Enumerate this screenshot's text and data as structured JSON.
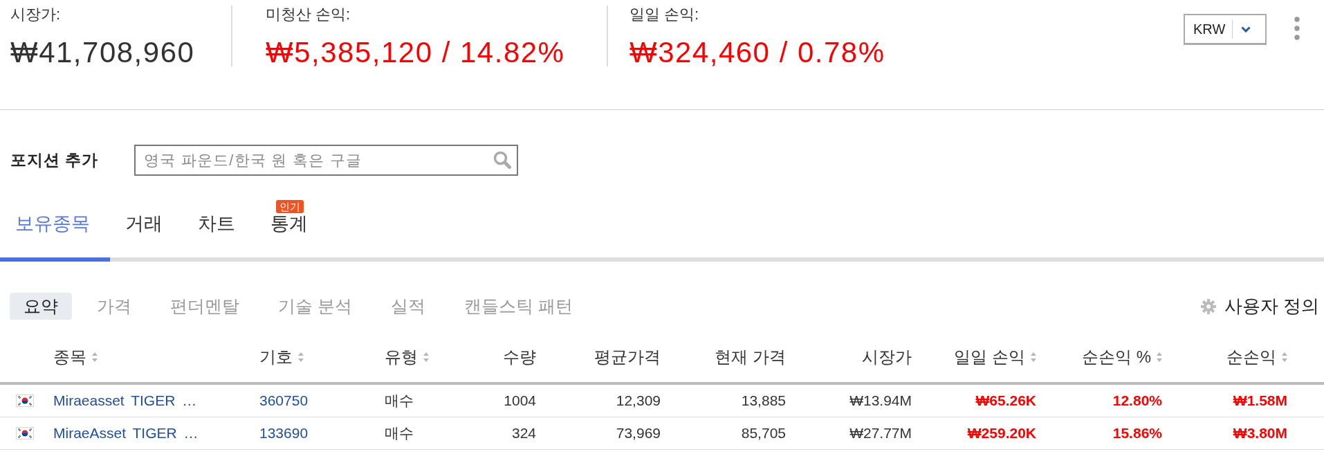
{
  "summary": [
    {
      "label": "시장가:",
      "value": "₩41,708,960",
      "kind": "total"
    },
    {
      "label": "미청산 손익:",
      "value": "₩5,385,120 / 14.82%",
      "kind": "change"
    },
    {
      "label": "일일 손익:",
      "value": "₩324,460 / 0.78%",
      "kind": "change"
    }
  ],
  "currency": {
    "value": "KRW"
  },
  "add_position": {
    "label": "포지션 추가",
    "placeholder": "영국 파운드/한국 원 혹은 구글"
  },
  "tabs": [
    {
      "label": "보유종목",
      "selected": true
    },
    {
      "label": "거래",
      "selected": false
    },
    {
      "label": "차트",
      "selected": false
    },
    {
      "label": "통계",
      "selected": false,
      "badge": "인기"
    }
  ],
  "views": [
    {
      "label": "요약",
      "selected": true
    },
    {
      "label": "가격",
      "selected": false
    },
    {
      "label": "편더멘탈",
      "selected": false
    },
    {
      "label": "기술 분석",
      "selected": false
    },
    {
      "label": "실적",
      "selected": false
    },
    {
      "label": "캔들스틱 패턴",
      "selected": false
    }
  ],
  "customize": {
    "label": "사용자 정의"
  },
  "table": {
    "columns": [
      {
        "label": "종목",
        "kind": "name",
        "sortable": true
      },
      {
        "label": "기호",
        "kind": "symbol",
        "sortable": true
      },
      {
        "label": "유형",
        "kind": "text",
        "sortable": true
      },
      {
        "label": "수량",
        "kind": "number",
        "sortable": false
      },
      {
        "label": "평균가격",
        "kind": "number",
        "sortable": false
      },
      {
        "label": "현재 가격",
        "kind": "number",
        "sortable": false
      },
      {
        "label": "시장가",
        "kind": "number",
        "sortable": false
      },
      {
        "label": "일일 손익",
        "kind": "change",
        "sortable": true
      },
      {
        "label": "순손익 %",
        "kind": "change",
        "sortable": true
      },
      {
        "label": "순손익",
        "kind": "change",
        "sortable": true
      }
    ],
    "rows": [
      {
        "cells": [
          "Miraeasset TIGER …",
          "360750",
          "매수",
          "1004",
          "12,309",
          "13,885",
          "₩13.94M",
          "₩65.26K",
          "12.80%",
          "₩1.58M"
        ]
      },
      {
        "cells": [
          "MiraeAsset TIGER …",
          "133690",
          "매수",
          "324",
          "73,969",
          "85,705",
          "₩27.77M",
          "₩259.20K",
          "15.86%",
          "₩3.80M"
        ]
      }
    ]
  }
}
